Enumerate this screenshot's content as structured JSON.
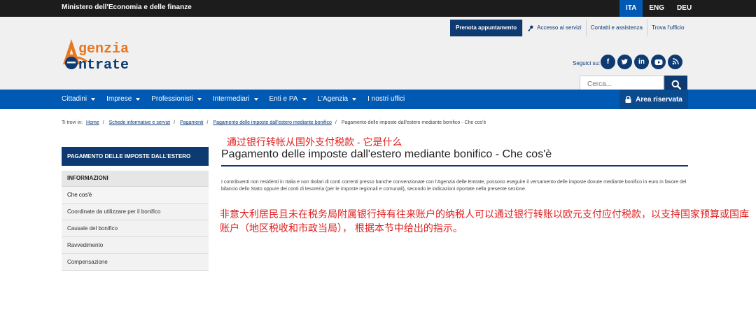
{
  "topbar": {
    "ministry": "Ministero dell'Economia e delle finanze",
    "languages": [
      "ITA",
      "ENG",
      "DEU"
    ]
  },
  "header": {
    "links": [
      "Prenota appuntamento",
      "Accesso ai servizi",
      "Contatti e assistenza",
      "Trova l'ufficio"
    ],
    "logo_text_1": "genzia",
    "logo_text_2": "ntrate",
    "follow_label": "Seguici su:",
    "social_icons": [
      "facebook-icon",
      "twitter-icon",
      "linkedin-icon",
      "youtube-icon",
      "rss-icon"
    ],
    "search_placeholder": "Cerca..."
  },
  "nav": {
    "items": [
      "Cittadini",
      "Imprese",
      "Professionisti",
      "Intermediari",
      "Enti e PA",
      "L'Agenzia",
      "I nostri uffici"
    ],
    "area_riservata": "Area riservata"
  },
  "breadcrumb": {
    "prefix": "Ti trovi in:",
    "items": [
      "Home",
      "Schede informative e servizi",
      "Pagamenti",
      "Pagamento delle imposte dall'estero mediante bonifico"
    ],
    "current": "Pagamento delle imposte dall'estero mediante bonifico - Che cos'è"
  },
  "sidebar": {
    "header": "PAGAMENTO DELLE IMPOSTE DALL'ESTERO",
    "category": "INFORMAZIONI",
    "items": [
      "Che cos'è",
      "Coordinate da utilizzare per il bonifico",
      "Causale del bonifico",
      "Ravvedimento",
      "Compensazione"
    ]
  },
  "main": {
    "annotation_title": "通过银行转帐从国外支付税款 - 它是什么",
    "title": "Pagamento delle imposte dall'estero mediante bonifico - Che cos'è",
    "body": "I contribuenti non residenti in Italia e non titolari di conti correnti presso banche convenzionate con l'Agenzia delle Entrate, possono eseguire il versamento delle imposte dovute mediante bonifico in euro in favore del bilancio dello Stato oppure dei conti di tesoreria (per le imposte regionali e comunali), secondo le indicazioni riportate nella presente sezione.",
    "annotation_body": "非意大利居民且未在税务局附属银行持有往来账户的纳税人可以通过银行转账以欧元支付应付税款，以支持国家预算或国库账户（地区税收和市政当局）， 根据本节中给出的指示。"
  },
  "colors": {
    "brand_dark": "#0d3a70",
    "brand_blue": "#0059b3",
    "logo_orange": "#e87722",
    "annotation": "#e02020"
  }
}
